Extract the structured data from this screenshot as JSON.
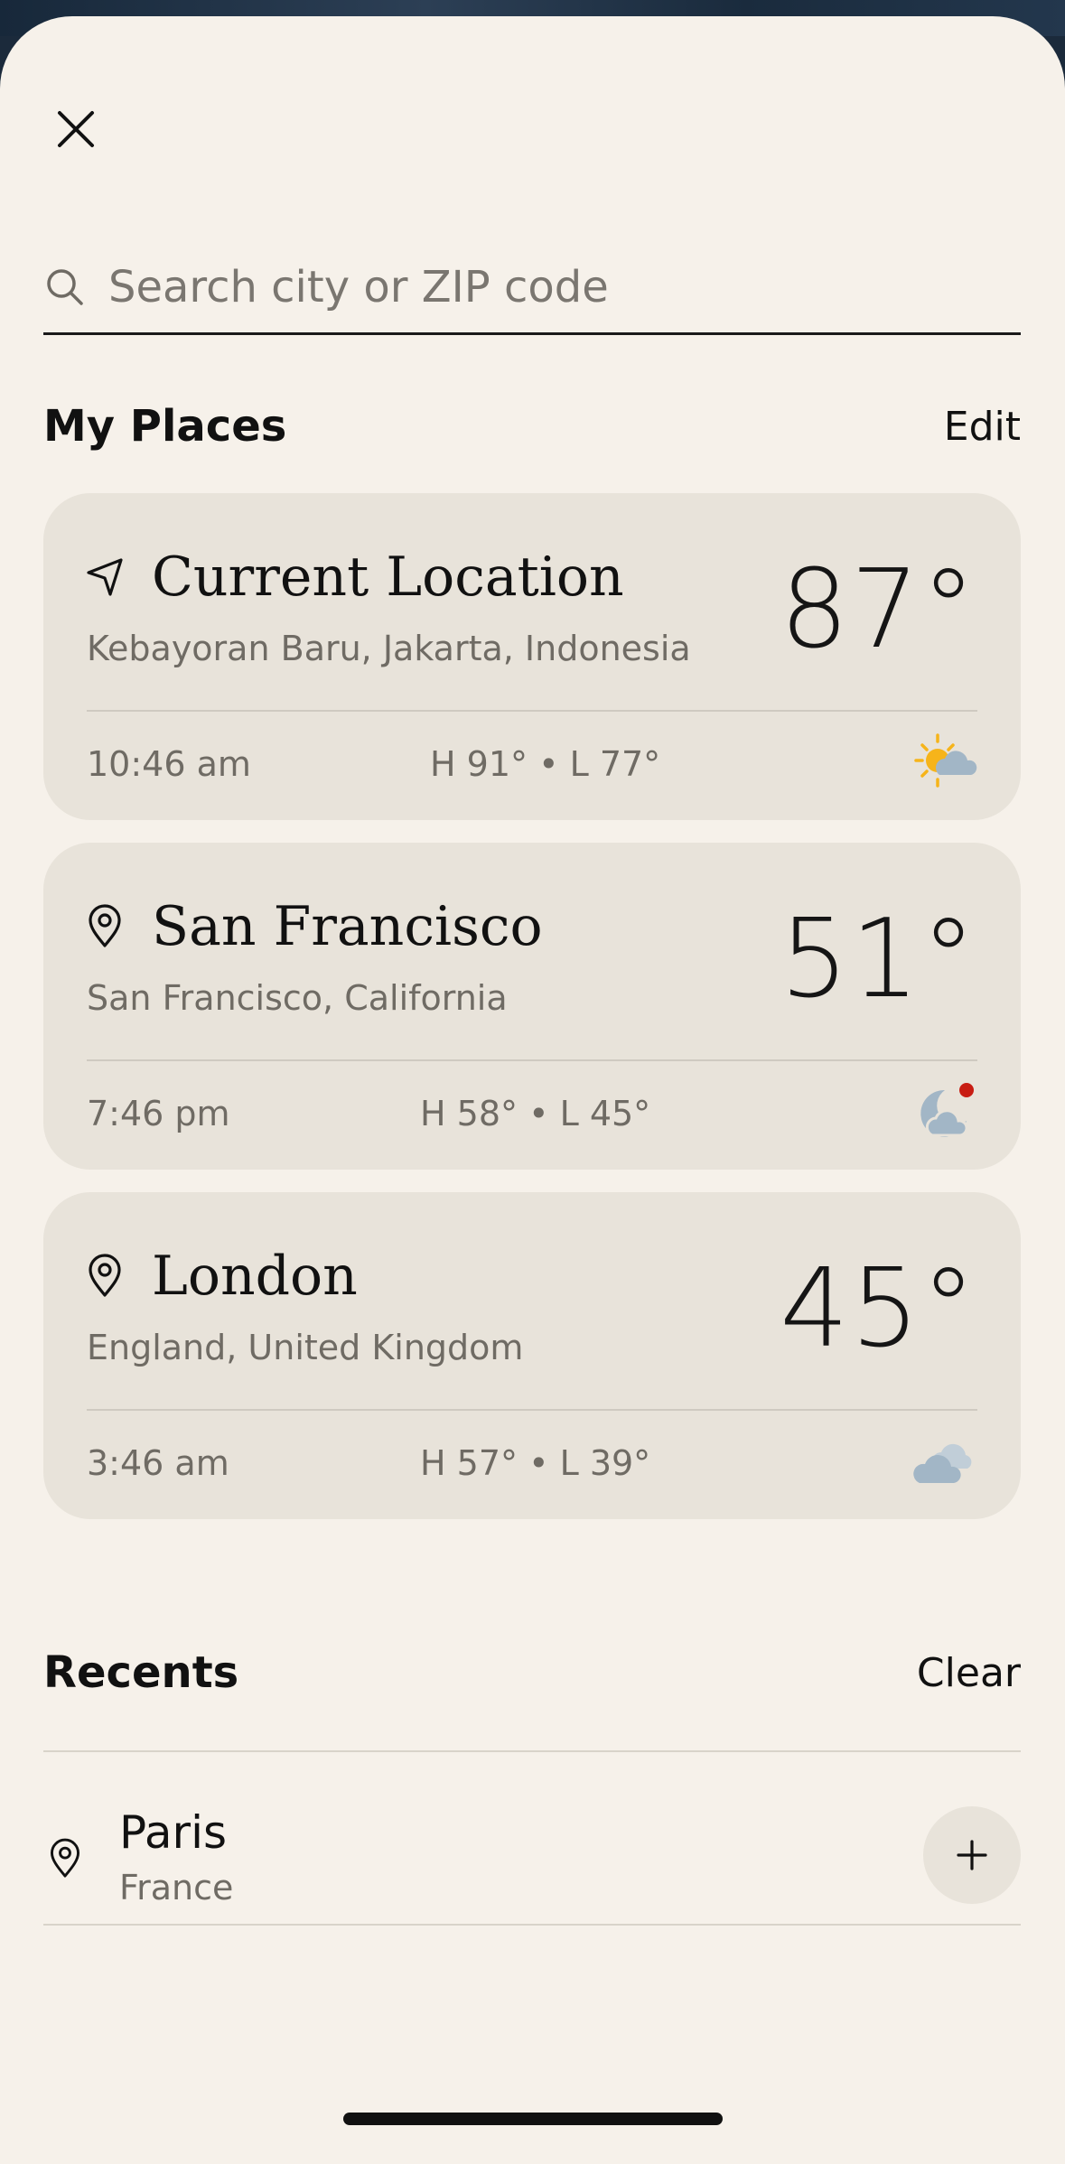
{
  "search": {
    "placeholder": "Search city or ZIP code"
  },
  "my_places": {
    "title": "My Places",
    "edit_label": "Edit",
    "cards": [
      {
        "city": "Current Location",
        "region": "Kebayoran Baru, Jakarta, Indonesia",
        "temp": "87°",
        "time": "10:46 am",
        "hilo": "H 91° • L 77°",
        "icon": "location-arrow-icon",
        "weather_icon": "partly-cloudy-day-icon"
      },
      {
        "city": "San Francisco",
        "region": "San Francisco, California",
        "temp": "51°",
        "time": "7:46 pm",
        "hilo": "H 58° • L 45°",
        "icon": "map-pin-icon",
        "weather_icon": "partly-cloudy-night-icon"
      },
      {
        "city": "London",
        "region": "England, United Kingdom",
        "temp": "45°",
        "time": "3:46 am",
        "hilo": "H 57° • L 39°",
        "icon": "map-pin-icon",
        "weather_icon": "cloudy-icon"
      }
    ]
  },
  "recents": {
    "title": "Recents",
    "clear_label": "Clear",
    "items": [
      {
        "city": "Paris",
        "country": "France"
      }
    ]
  },
  "colors": {
    "sheet_background": "#f6f1ea",
    "card_background": "#e8e3da",
    "alert_dot": "#c81d13",
    "sun": "#f6b41a",
    "cloud": "#a2b6c6"
  }
}
